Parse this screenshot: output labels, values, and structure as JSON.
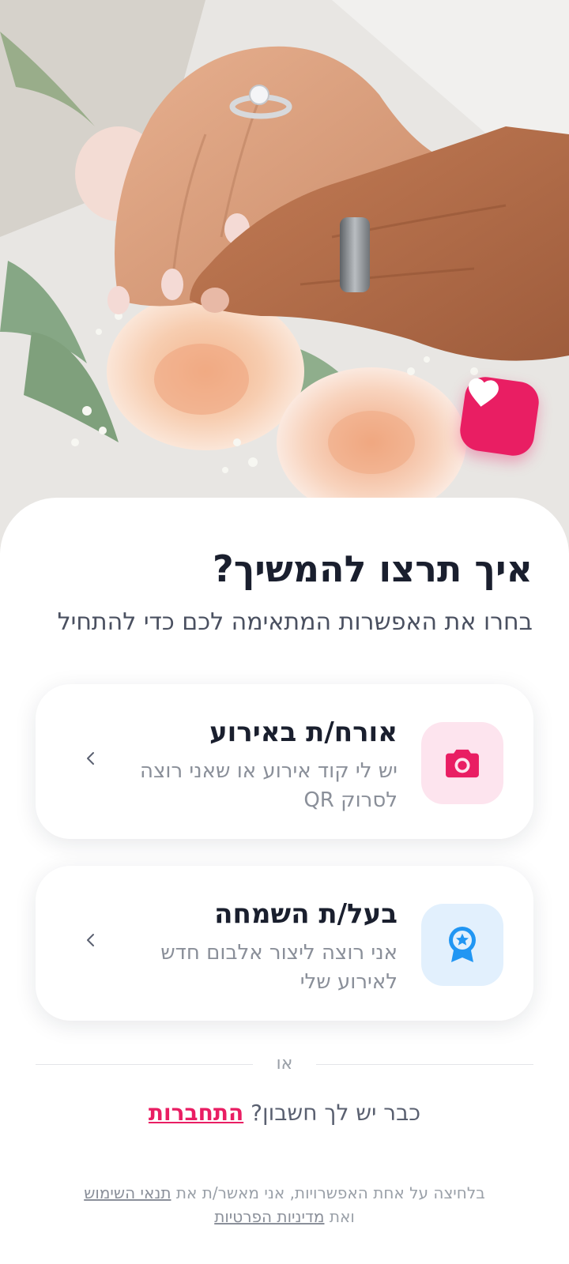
{
  "hero": {
    "image_alt": "wedding hands with rings on flower bouquet",
    "badge_icon": "heart-icon",
    "accent": "#e91e63"
  },
  "header": {
    "title": "איך תרצו להמשיך?",
    "subtitle": "בחרו את האפשרות המתאימה לכם כדי להתחיל"
  },
  "options": [
    {
      "title": "אורח/ת באירוע",
      "description": "יש לי קוד אירוע או שאני רוצה לסרוק QR",
      "icon": "camera-icon",
      "icon_bg": "#fde4ee",
      "icon_color": "#e91e63"
    },
    {
      "title": "בעל/ת השמחה",
      "description": "אני רוצה ליצור אלבום חדש לאירוע שלי",
      "icon": "award-ribbon-icon",
      "icon_bg": "#e2f0fd",
      "icon_color": "#2196f3"
    }
  ],
  "divider": {
    "label": "או"
  },
  "login": {
    "prompt": "כבר יש לך חשבון?",
    "link": "התחברות"
  },
  "legal": {
    "prefix": "בלחיצה על אחת האפשרויות, אני מאשר/ת את",
    "terms_link": "תנאי השימוש",
    "middle": "ואת",
    "privacy_link": "מדיניות הפרטיות"
  }
}
